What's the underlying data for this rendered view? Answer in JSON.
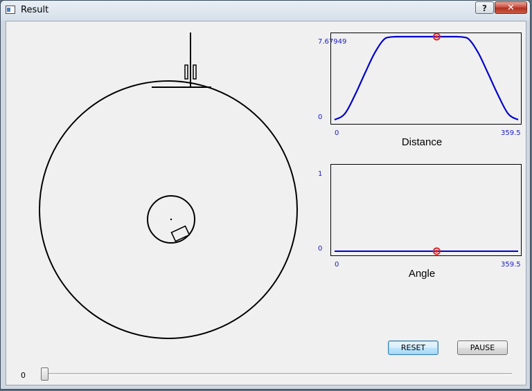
{
  "window": {
    "title": "Result",
    "help_label": "?",
    "close_label": "✕"
  },
  "distance_plot": {
    "caption": "Distance",
    "y_max_label": "7.67949",
    "y_min_label": "0",
    "x_min_label": "0",
    "x_max_label": "359.5",
    "line_color": "#0000cc",
    "marker_color": "#e02020"
  },
  "angle_plot": {
    "caption": "Angle",
    "y_max_label": "1",
    "y_min_label": "0",
    "x_min_label": "0",
    "x_max_label": "359.5",
    "line_color": "#0000cc",
    "marker_color": "#e02020"
  },
  "chart_data": [
    {
      "type": "line",
      "title": "Distance",
      "xlim": [
        0,
        359.5
      ],
      "ylim": [
        0,
        7.67949
      ],
      "x": [
        0,
        20,
        40,
        60,
        80,
        100,
        120,
        140,
        160,
        180,
        200,
        220,
        240,
        260,
        280,
        300,
        320,
        340,
        359.5
      ],
      "y": [
        0,
        0.55,
        2.3,
        4.35,
        6.3,
        7.55,
        7.67949,
        7.67949,
        7.67949,
        7.67949,
        7.67949,
        7.67949,
        7.67949,
        7.55,
        6.3,
        4.35,
        2.3,
        0.55,
        0
      ],
      "marker": {
        "x": 200,
        "y": 7.67949
      }
    },
    {
      "type": "line",
      "title": "Angle",
      "xlim": [
        0,
        359.5
      ],
      "ylim": [
        0,
        1
      ],
      "x": [
        0,
        359.5
      ],
      "y": [
        0,
        0
      ],
      "marker": {
        "x": 200,
        "y": 0
      }
    }
  ],
  "controls": {
    "reset_label": "RESET",
    "pause_label": "PAUSE",
    "slider_value": "0"
  }
}
